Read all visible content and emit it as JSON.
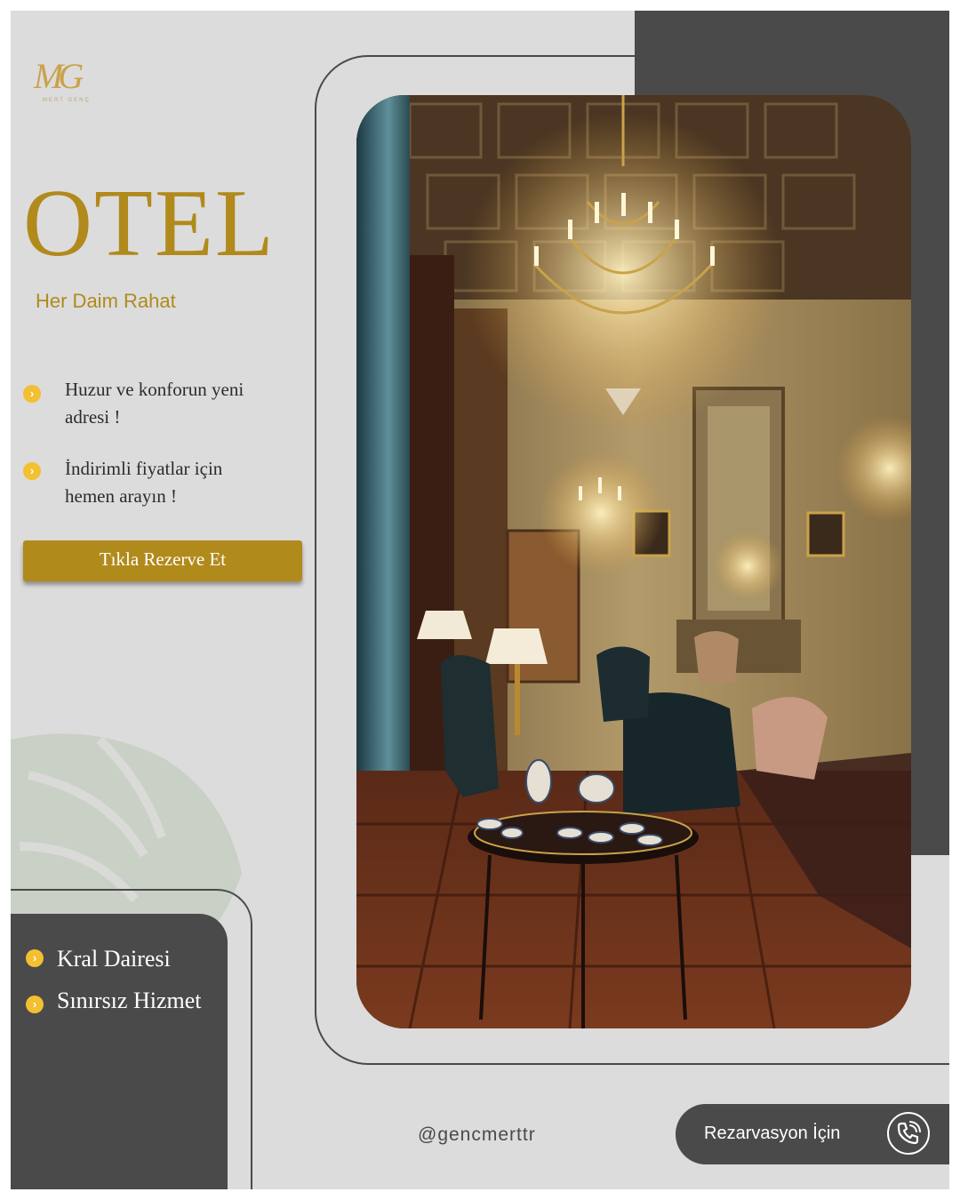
{
  "brand": {
    "logo_text": "MG",
    "logo_sub": "MERT GENÇ"
  },
  "hero": {
    "title": "OTEL",
    "subtitle": "Her Daim Rahat"
  },
  "features": [
    {
      "line1": "Huzur ve konforun yeni",
      "line2": "adresi !"
    },
    {
      "line1": "İndirimli fiyatlar için",
      "line2": "hemen arayın !"
    }
  ],
  "cta": {
    "label": "Tıkla Rezerve Et"
  },
  "services": [
    {
      "label": "Kral Dairesi"
    },
    {
      "label": "Sınırsız Hizmet"
    }
  ],
  "footer": {
    "handle": "@gencmerttr",
    "reservation_label": "Rezarvasyon İçin"
  },
  "icons": {
    "bullet": "chevron-right-icon",
    "phone": "phone-icon",
    "photo": "chandelier-hotel-lobby-photo",
    "leaf": "monstera-leaf-icon"
  },
  "colors": {
    "gold": "#b18a1c",
    "dark": "#4a4a4a",
    "background": "#dcdcdc",
    "bullet": "#f2c030"
  }
}
